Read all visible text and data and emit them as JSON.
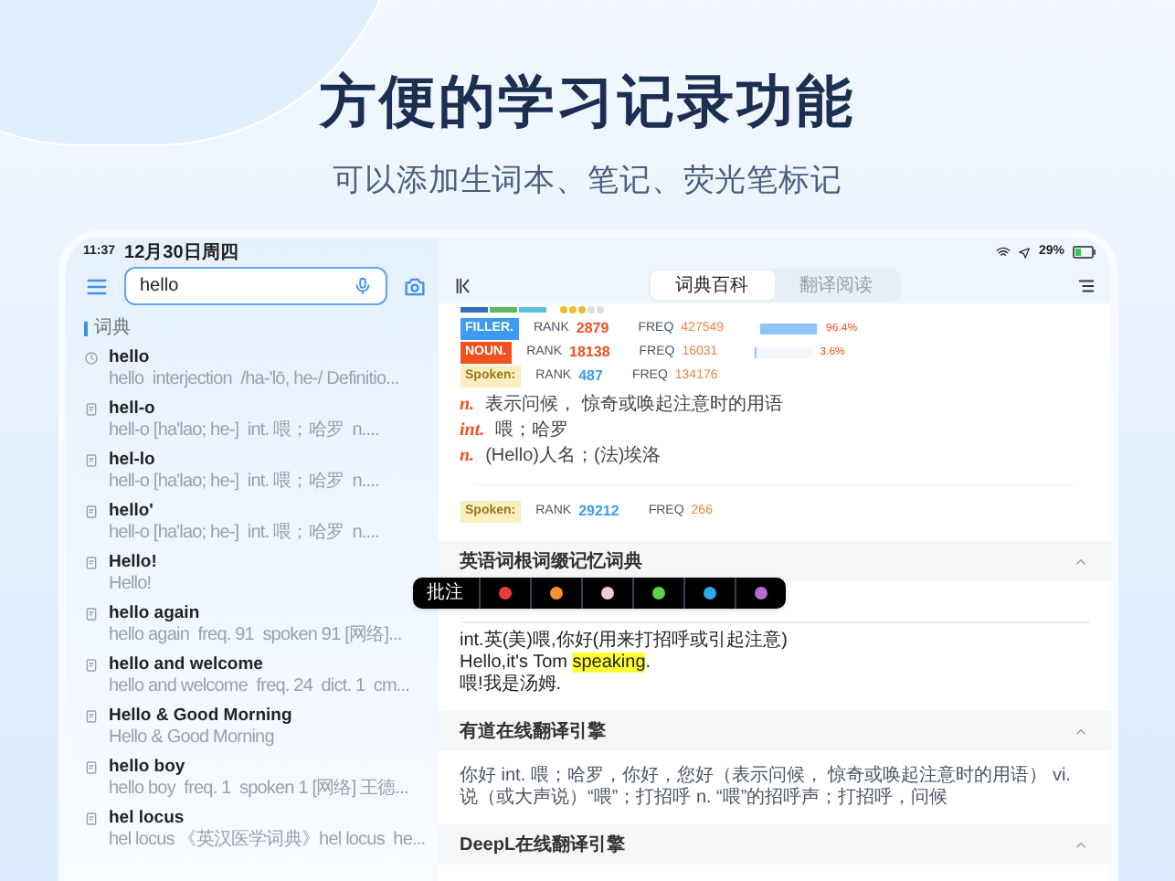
{
  "headline": "方便的学习记录功能",
  "subtitle": "可以添加生词本、笔记、荧光笔标记",
  "status_bar": {
    "time": "11:37",
    "date": "12月30日周四",
    "battery": "29%"
  },
  "search": {
    "value": "hello"
  },
  "sidebar": {
    "section": "词典",
    "items": [
      {
        "kind": "history",
        "word": "hello",
        "summary": "hello  interjection  /ha-'lō, he-/ Definitio..."
      },
      {
        "kind": "entry",
        "word": "hell-o",
        "summary": "hell-o [ha'lao; he-]  int. 喂；哈罗  n...."
      },
      {
        "kind": "entry",
        "word": "hel-lo",
        "summary": "hell-o [ha'lao; he-]  int. 喂；哈罗  n...."
      },
      {
        "kind": "entry",
        "word": "hello'",
        "summary": "hell-o [ha'lao; he-]  int. 喂；哈罗  n...."
      },
      {
        "kind": "entry",
        "word": "Hello!",
        "summary": "Hello!"
      },
      {
        "kind": "entry",
        "word": "hello again",
        "summary": "hello again  freq. 91  spoken 91 [网络]..."
      },
      {
        "kind": "entry",
        "word": "hello and welcome",
        "summary": "hello and welcome  freq. 24  dict. 1  cm..."
      },
      {
        "kind": "entry",
        "word": "Hello & Good Morning",
        "summary": "Hello & Good Morning"
      },
      {
        "kind": "entry",
        "word": "hello boy",
        "summary": "hello boy  freq. 1  spoken 1 [网络] 王德..."
      },
      {
        "kind": "entry",
        "word": "hel locus",
        "summary": "hel locus 《英汉医学词典》hel locus  he..."
      }
    ]
  },
  "tabs": [
    {
      "label": "词典百科",
      "selected": true
    },
    {
      "label": "翻译阅读",
      "selected": false
    }
  ],
  "stars": 3,
  "ranks": [
    {
      "kind": "filler",
      "tag": "FILLER.",
      "rank_label": "RANK",
      "rank": "2879",
      "freq_label": "FREQ",
      "freq": "427549",
      "level": 0.964,
      "percent": "96.4%"
    },
    {
      "kind": "noun",
      "tag": "NOUN.",
      "rank_label": "RANK",
      "rank": "18138",
      "freq_label": "FREQ",
      "freq": "16031",
      "level": 0.036,
      "percent": "3.6%"
    },
    {
      "kind": "spoken",
      "tag": "Spoken:",
      "rank_label": "RANK",
      "rank": "487",
      "freq_label": "FREQ",
      "freq": "134176"
    }
  ],
  "definitions": [
    {
      "pos": "n.",
      "text": "表示问候， 惊奇或唤起注意时的用语"
    },
    {
      "pos": "int.",
      "text": "喂；哈罗"
    },
    {
      "pos": "n.",
      "text": "(Hello)人名；(法)埃洛"
    }
  ],
  "spoken_rank": {
    "kind": "spoken",
    "tag": "Spoken:",
    "rank_label": "RANK",
    "rank": "29212",
    "freq_label": "FREQ",
    "freq": "266"
  },
  "sections": [
    {
      "title": "英语词根词缀记忆词典",
      "expanded": true,
      "lines": [
        [
          {
            "text": "int.英(美)喂,你好(用来打招呼或引起注意)",
            "highlighted": false
          }
        ],
        [
          {
            "text": "Hello,it's Tom ",
            "highlighted": false
          },
          {
            "text": "speaking",
            "highlighted": true
          },
          {
            "text": ".",
            "highlighted": false
          }
        ],
        [
          {
            "text": "喂!我是汤姆.",
            "highlighted": false
          }
        ]
      ]
    },
    {
      "title": "有道在线翻译引擎",
      "expanded": true,
      "lines": [
        [
          {
            "text": "你好 int. 喂；哈罗，你好，您好（表示问候， 惊奇或唤起注意时的用语） vi. 说（或大声说）“喂”；打招呼 n. “喂”的招呼声；打招呼，问候",
            "highlighted": false
          }
        ]
      ]
    },
    {
      "title": "DeepL在线翻译引擎",
      "expanded": true
    }
  ],
  "annotation_toolbar": {
    "label": "批注",
    "colors": [
      {
        "color": "#f03c3c"
      },
      {
        "color": "#f5922f"
      },
      {
        "color": "#f6c8d8"
      },
      {
        "color": "#5fcf4a"
      },
      {
        "color": "#2aa8f0"
      },
      {
        "color": "#b56ad6"
      }
    ]
  }
}
